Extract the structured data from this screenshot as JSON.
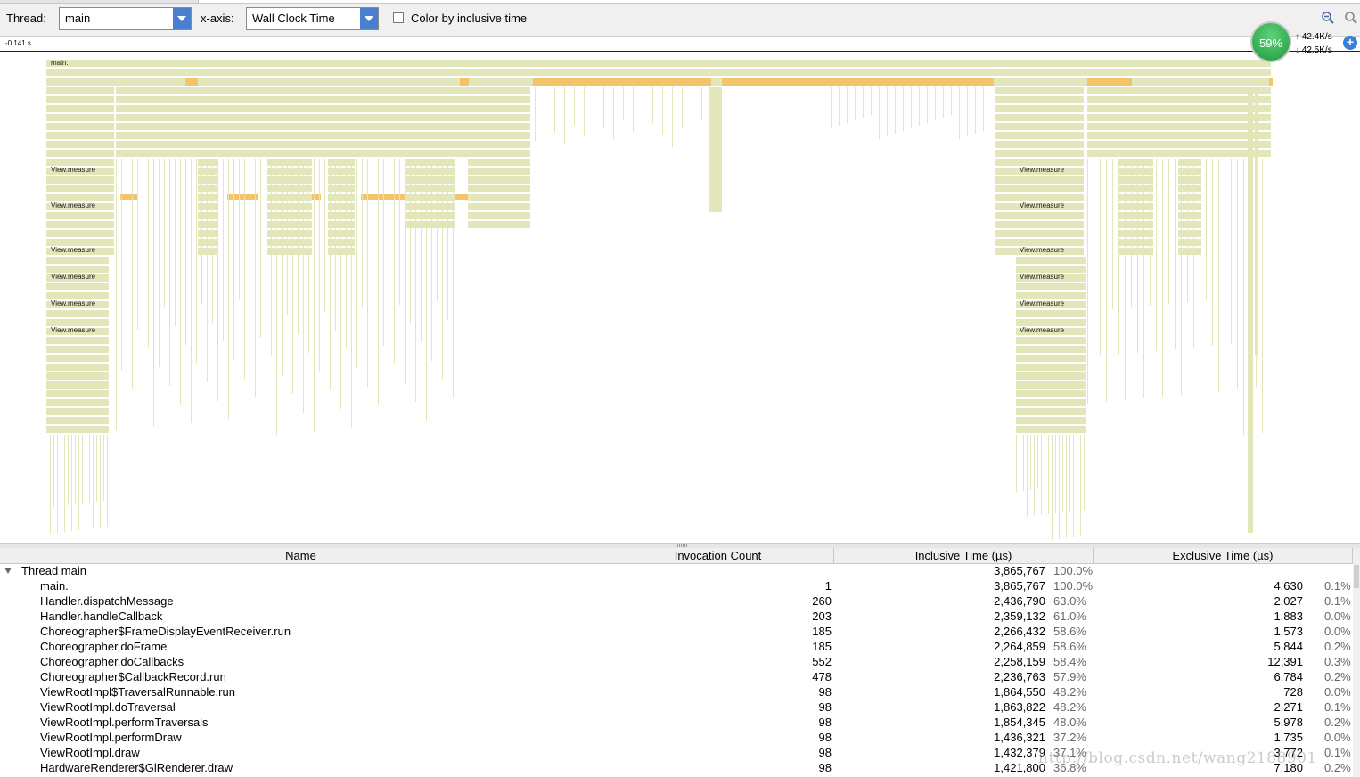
{
  "toolbar": {
    "thread_label": "Thread:",
    "thread_value": "main",
    "xaxis_label": "x-axis:",
    "xaxis_value": "Wall Clock Time",
    "color_by_label": "Color by inclusive time",
    "color_by_checked": false
  },
  "ruler": {
    "start_label": "-0.141 s"
  },
  "timeline": {
    "labels": {
      "main": "main.",
      "measure": "View.measure"
    }
  },
  "net_widget": {
    "percent": "59%",
    "up": "42.4K/s",
    "down": "42.5K/s"
  },
  "table": {
    "headers": {
      "name": "Name",
      "invocation": "Invocation Count",
      "inclusive": "Inclusive Time (µs)",
      "exclusive": "Exclusive Time (µs)"
    },
    "thread_row": {
      "name": "Thread main",
      "inclusive": "3,865,767",
      "inclusive_pct": "100.0%"
    },
    "rows": [
      {
        "name": "main.",
        "count": "1",
        "incl": "3,865,767",
        "incl_pct": "100.0%",
        "excl": "4,630",
        "excl_pct": "0.1%"
      },
      {
        "name": "Handler.dispatchMessage",
        "count": "260",
        "incl": "2,436,790",
        "incl_pct": "63.0%",
        "excl": "2,027",
        "excl_pct": "0.1%"
      },
      {
        "name": "Handler.handleCallback",
        "count": "203",
        "incl": "2,359,132",
        "incl_pct": "61.0%",
        "excl": "1,883",
        "excl_pct": "0.0%"
      },
      {
        "name": "Choreographer$FrameDisplayEventReceiver.run",
        "count": "185",
        "incl": "2,266,432",
        "incl_pct": "58.6%",
        "excl": "1,573",
        "excl_pct": "0.0%"
      },
      {
        "name": "Choreographer.doFrame",
        "count": "185",
        "incl": "2,264,859",
        "incl_pct": "58.6%",
        "excl": "5,844",
        "excl_pct": "0.2%"
      },
      {
        "name": "Choreographer.doCallbacks",
        "count": "552",
        "incl": "2,258,159",
        "incl_pct": "58.4%",
        "excl": "12,391",
        "excl_pct": "0.3%"
      },
      {
        "name": "Choreographer$CallbackRecord.run",
        "count": "478",
        "incl": "2,236,763",
        "incl_pct": "57.9%",
        "excl": "6,784",
        "excl_pct": "0.2%"
      },
      {
        "name": "ViewRootImpl$TraversalRunnable.run",
        "count": "98",
        "incl": "1,864,550",
        "incl_pct": "48.2%",
        "excl": "728",
        "excl_pct": "0.0%"
      },
      {
        "name": "ViewRootImpl.doTraversal",
        "count": "98",
        "incl": "1,863,822",
        "incl_pct": "48.2%",
        "excl": "2,271",
        "excl_pct": "0.1%"
      },
      {
        "name": "ViewRootImpl.performTraversals",
        "count": "98",
        "incl": "1,854,345",
        "incl_pct": "48.0%",
        "excl": "5,978",
        "excl_pct": "0.2%"
      },
      {
        "name": "ViewRootImpl.performDraw",
        "count": "98",
        "incl": "1,436,321",
        "incl_pct": "37.2%",
        "excl": "1,735",
        "excl_pct": "0.0%"
      },
      {
        "name": "ViewRootImpl.draw",
        "count": "98",
        "incl": "1,432,379",
        "incl_pct": "37.1%",
        "excl": "3,772",
        "excl_pct": "0.1%"
      },
      {
        "name": "HardwareRenderer$GlRenderer.draw",
        "count": "98",
        "incl": "1,421,800",
        "incl_pct": "36.8%",
        "excl": "7,180",
        "excl_pct": "0.2%"
      }
    ]
  },
  "watermark": "http://blog.csdn.net/wang2188901",
  "colors": {
    "bar": "#e2e6b8",
    "hot": "#f3c46a",
    "accent": "#4a7fd0"
  }
}
